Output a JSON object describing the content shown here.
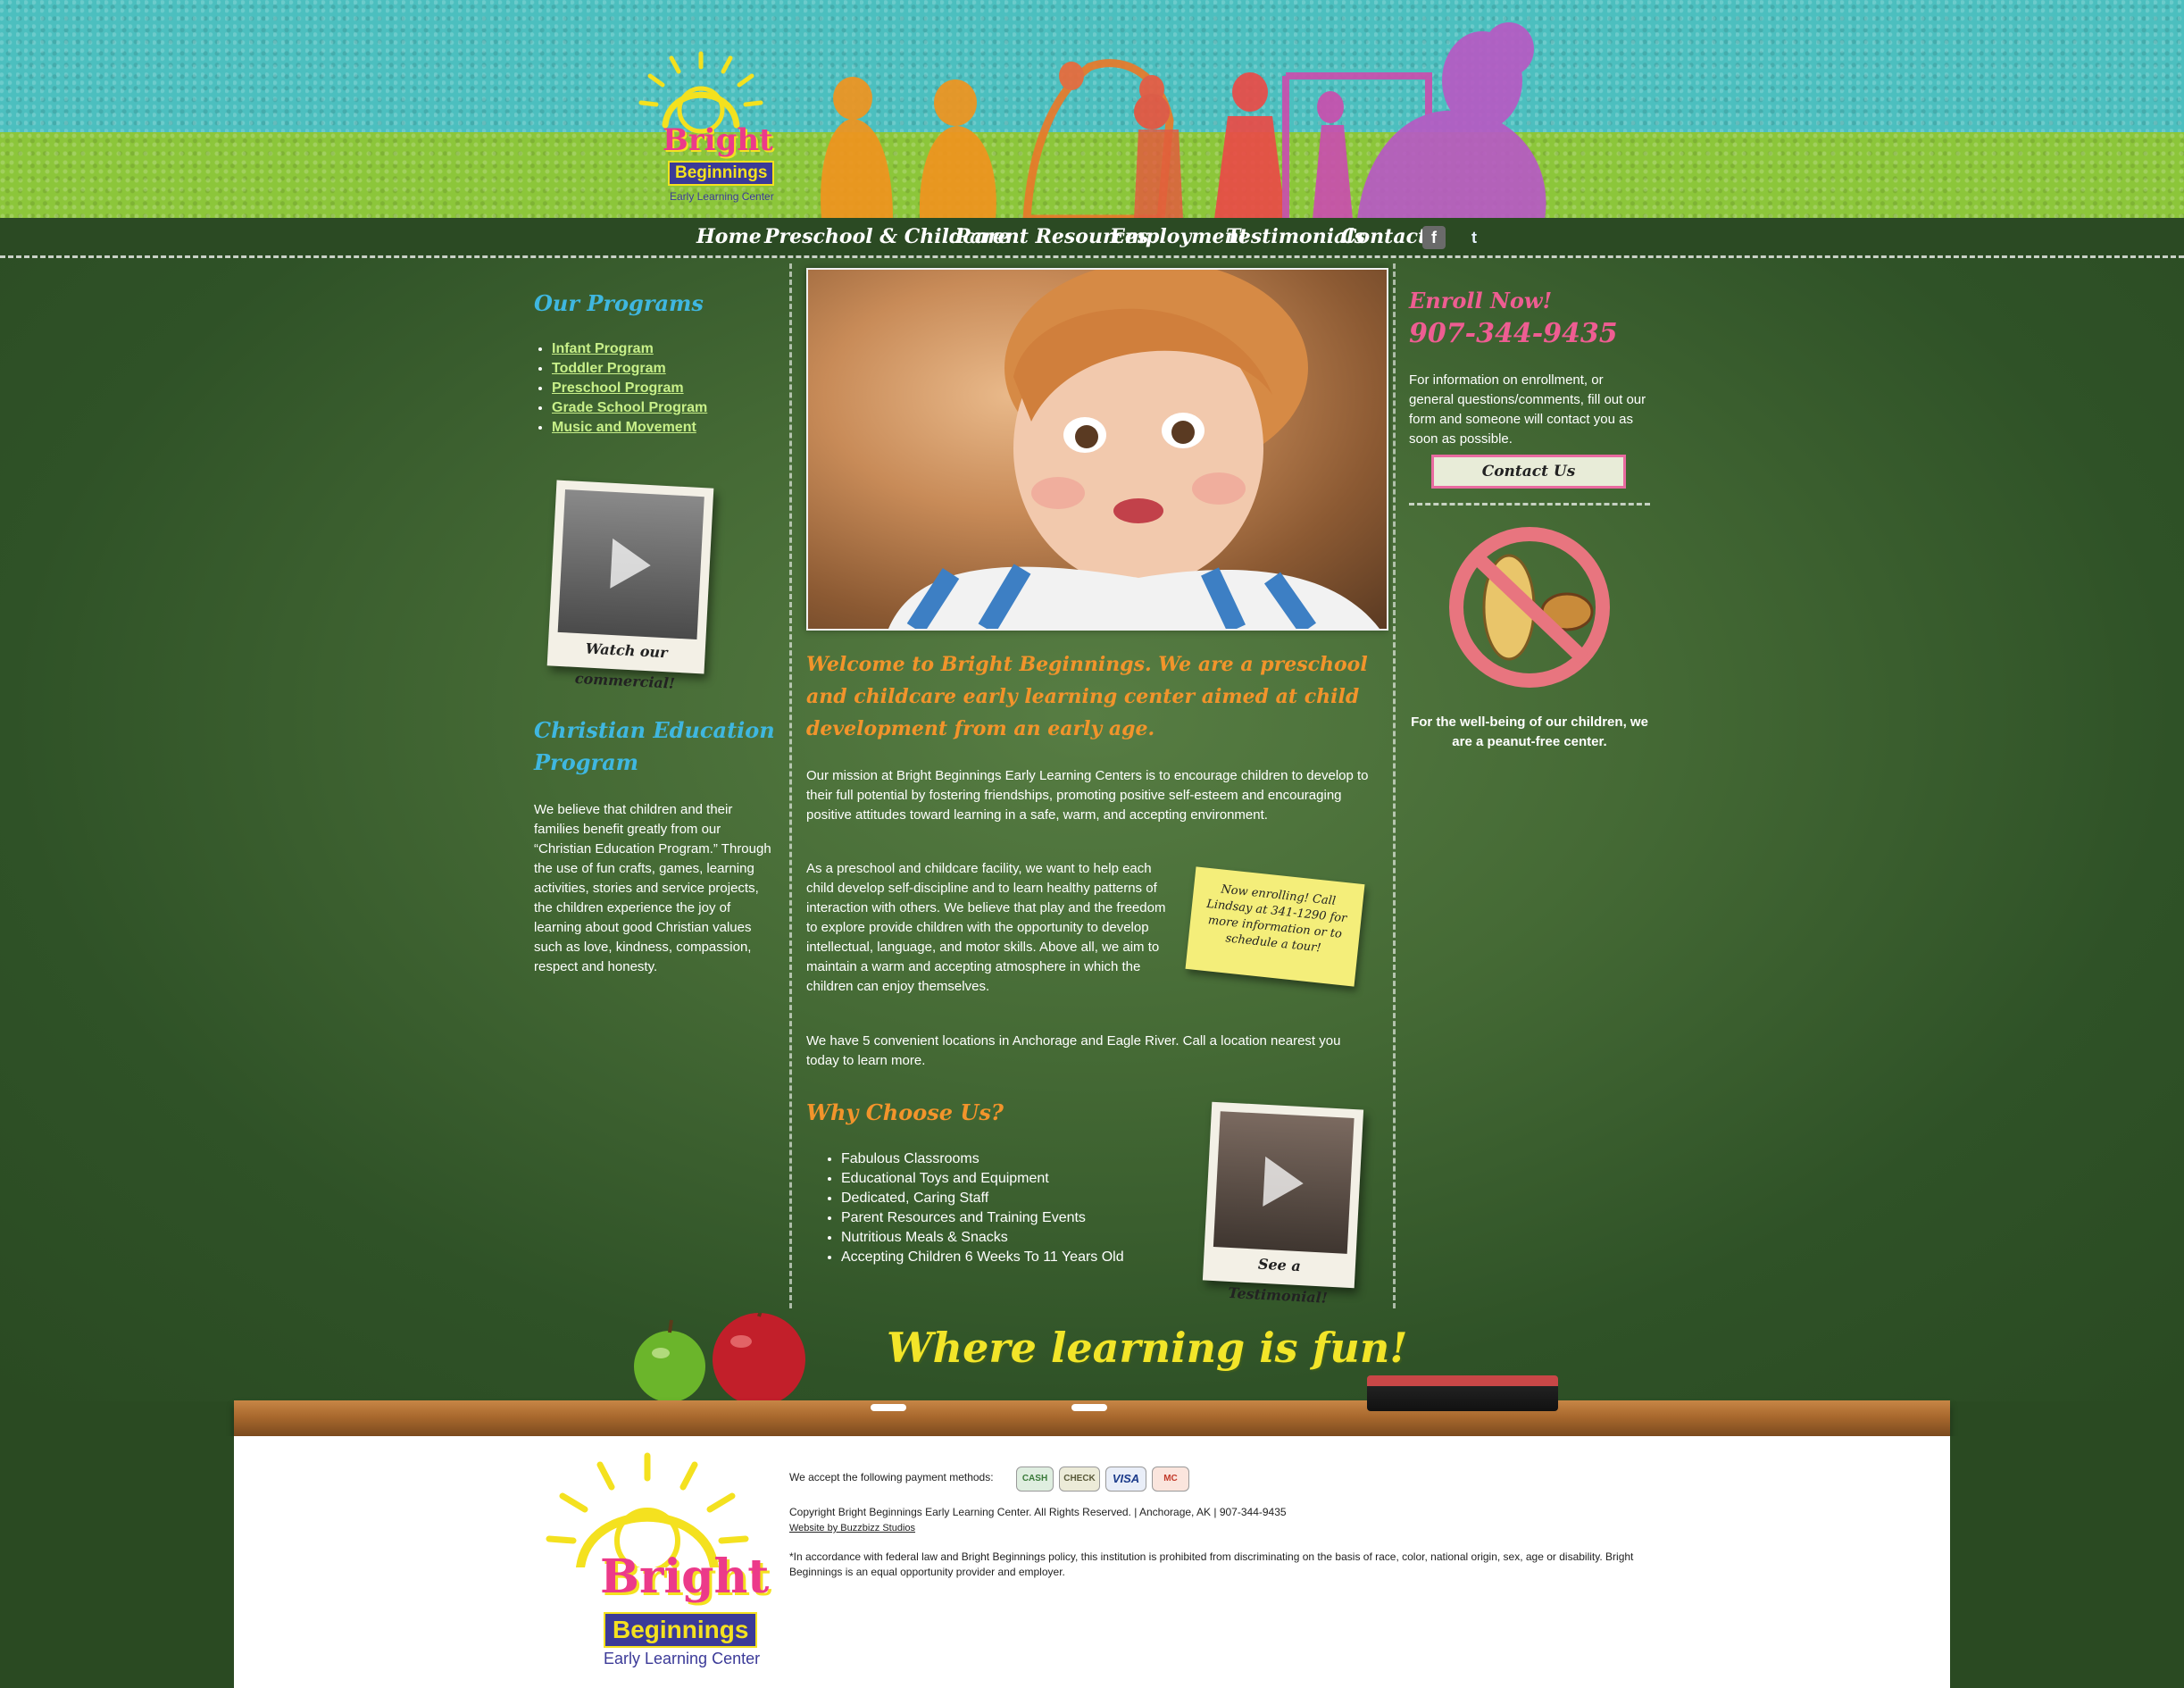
{
  "brand": {
    "name_line1": "Bright",
    "name_line2": "Beginnings",
    "tagline": "Early Learning Center",
    "colors": {
      "sky": "#4cbfbf",
      "grass": "#8cc63a",
      "board": "#456a35",
      "accent_orange": "#f2942b",
      "accent_blue": "#3fb7e0",
      "accent_pink": "#ee5d92"
    }
  },
  "nav": {
    "items": [
      "Home",
      "Preschool & Childcare",
      "Parent Resources",
      "Employment",
      "Testimonials",
      "Contact"
    ],
    "social": [
      {
        "icon": "facebook-icon",
        "glyph": "f"
      },
      {
        "icon": "twitter-icon",
        "glyph": "t"
      }
    ]
  },
  "left": {
    "programs_heading": "Our Programs",
    "programs": [
      "Infant Program",
      "Toddler Program",
      "Preschool Program",
      "Grade School Program",
      "Music and Movement"
    ],
    "commercial_caption": "Watch our commercial!",
    "christian_heading_1": "Christian Education",
    "christian_heading_2": "Program",
    "christian_text": "We believe that children and their families benefit greatly from our “Christian Education Program.” Through the use of fun crafts, games, learning activities, stories and service projects, the children experience the joy of learning about good Christian values such as love, kindness, compassion, respect and honesty."
  },
  "main": {
    "welcome": "Welcome to Bright Beginnings. We are a preschool and childcare early learning center aimed at child development from an early age.",
    "mission": "Our mission at Bright Beginnings Early Learning Centers is to encourage children to develop to their full potential by fostering friendships, promoting positive self-esteem and encouraging positive attitudes toward learning in a safe, warm, and accepting environment.",
    "facility": "As a preschool and childcare facility, we want to help each child develop self-discipline and to learn healthy patterns of interaction with others. We believe that play and the freedom to explore provide children with the opportunity to develop intellectual, language, and motor skills. Above all, we aim to maintain a warm and accepting atmosphere in which the children can enjoy themselves.",
    "locations": "We have 5 convenient locations in Anchorage and Eagle River. Call a location nearest you today to learn more.",
    "sticky_note": "Now enrolling! Call Lindsay at 341-1290 for more information or to schedule a tour!",
    "why_heading": "Why Choose Us?",
    "why_items": [
      "Fabulous Classrooms",
      "Educational Toys and Equipment",
      "Dedicated, Caring Staff",
      "Parent Resources and Training Events",
      "Nutritious Meals & Snacks",
      "Accepting Children 6 Weeks To 11 Years Old"
    ],
    "testimonial_caption": "See a Testimonial!"
  },
  "right": {
    "enroll_heading": "Enroll Now!",
    "phone": "907-344-9435",
    "info_text": "For information on enrollment, or general questions/comments, fill out our form and someone will contact you as soon as possible.",
    "contact_button": "Contact Us",
    "peanut_text": "For the well-being of our children, we are a peanut-free center."
  },
  "slogan": "Where learning is fun!",
  "footer": {
    "payment_label": "We accept the following payment methods:",
    "payment_methods": [
      "CASH",
      "CHECK",
      "VISA",
      "MC"
    ],
    "copyright": "Copyright Bright Beginnings Early Learning Center. All Rights Reserved. | Anchorage, AK | 907-344-9435",
    "credit_link": "Website by Buzzbizz Studios",
    "disclaimer": "*In accordance with federal law and Bright Beginnings policy, this institution is prohibited from discriminating on the basis of race, color, national origin, sex, age or disability. Bright Beginnings is an equal opportunity provider and employer."
  }
}
